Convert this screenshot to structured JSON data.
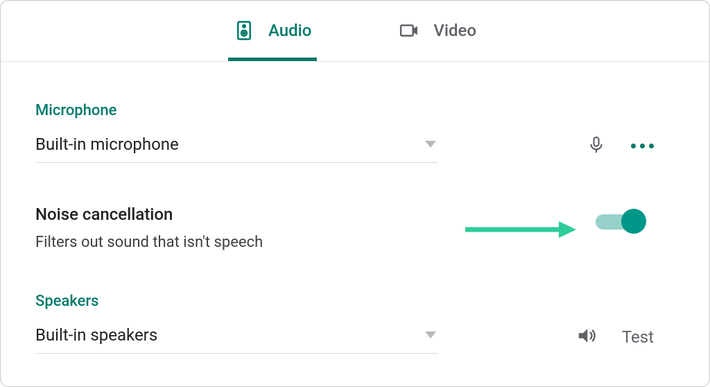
{
  "tabs": {
    "audio": {
      "label": "Audio",
      "active": true
    },
    "video": {
      "label": "Video",
      "active": false
    }
  },
  "microphone": {
    "section_label": "Microphone",
    "selected": "Built-in microphone"
  },
  "noise_cancellation": {
    "title": "Noise cancellation",
    "description": "Filters out sound that isn't speech",
    "enabled": true
  },
  "speakers": {
    "section_label": "Speakers",
    "selected": "Built-in speakers",
    "test_label": "Test"
  },
  "colors": {
    "accent": "#00796b",
    "toggle_on": "#009688",
    "toggle_track": "#95d0c9",
    "text_primary": "#202124",
    "text_secondary": "#5f6368",
    "annotation_arrow": "#2ecc9b"
  }
}
